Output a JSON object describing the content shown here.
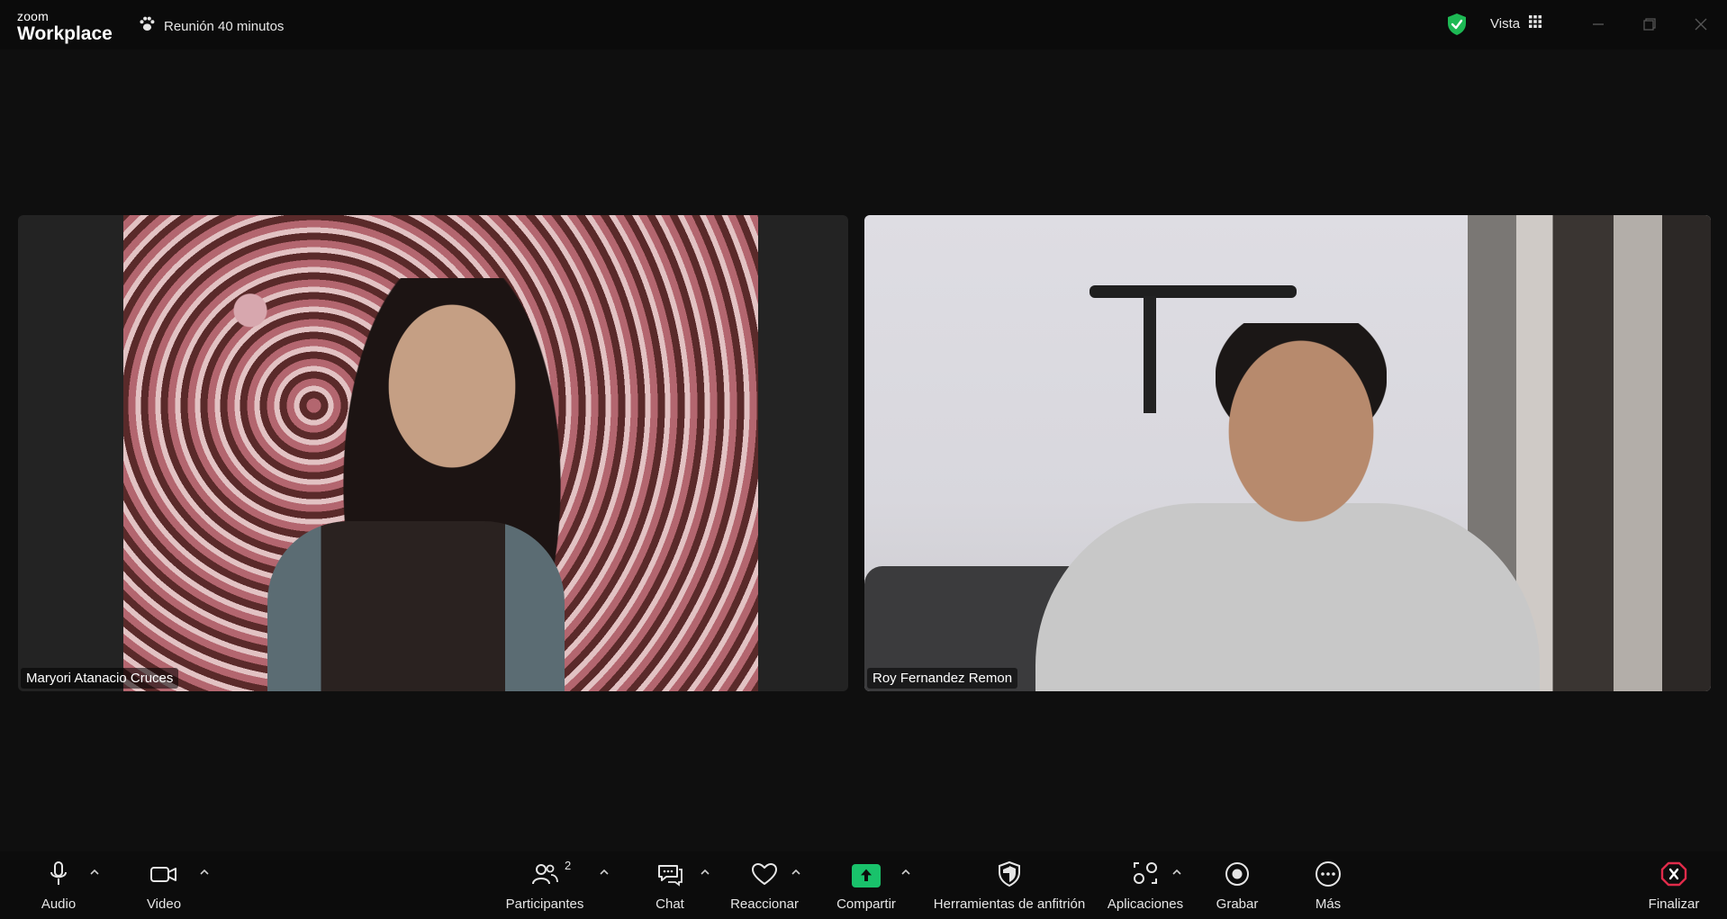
{
  "app": {
    "brand_small": "zoom",
    "brand_large": "Workplace",
    "meeting_title": "Reunión 40 minutos",
    "view_label": "Vista"
  },
  "participants": [
    {
      "name": "Maryori Atanacio Cruces"
    },
    {
      "name": "Roy Fernandez Remon"
    }
  ],
  "toolbar": {
    "audio": "Audio",
    "video": "Video",
    "participants": "Participantes",
    "participants_count": "2",
    "chat": "Chat",
    "react": "Reaccionar",
    "share": "Compartir",
    "host_tools": "Herramientas de anfitrión",
    "apps": "Aplicaciones",
    "record": "Grabar",
    "more": "Más",
    "end": "Finalizar"
  },
  "colors": {
    "share_green": "#19c26b",
    "shield_green": "#1db954",
    "end_red": "#e02b4a"
  }
}
